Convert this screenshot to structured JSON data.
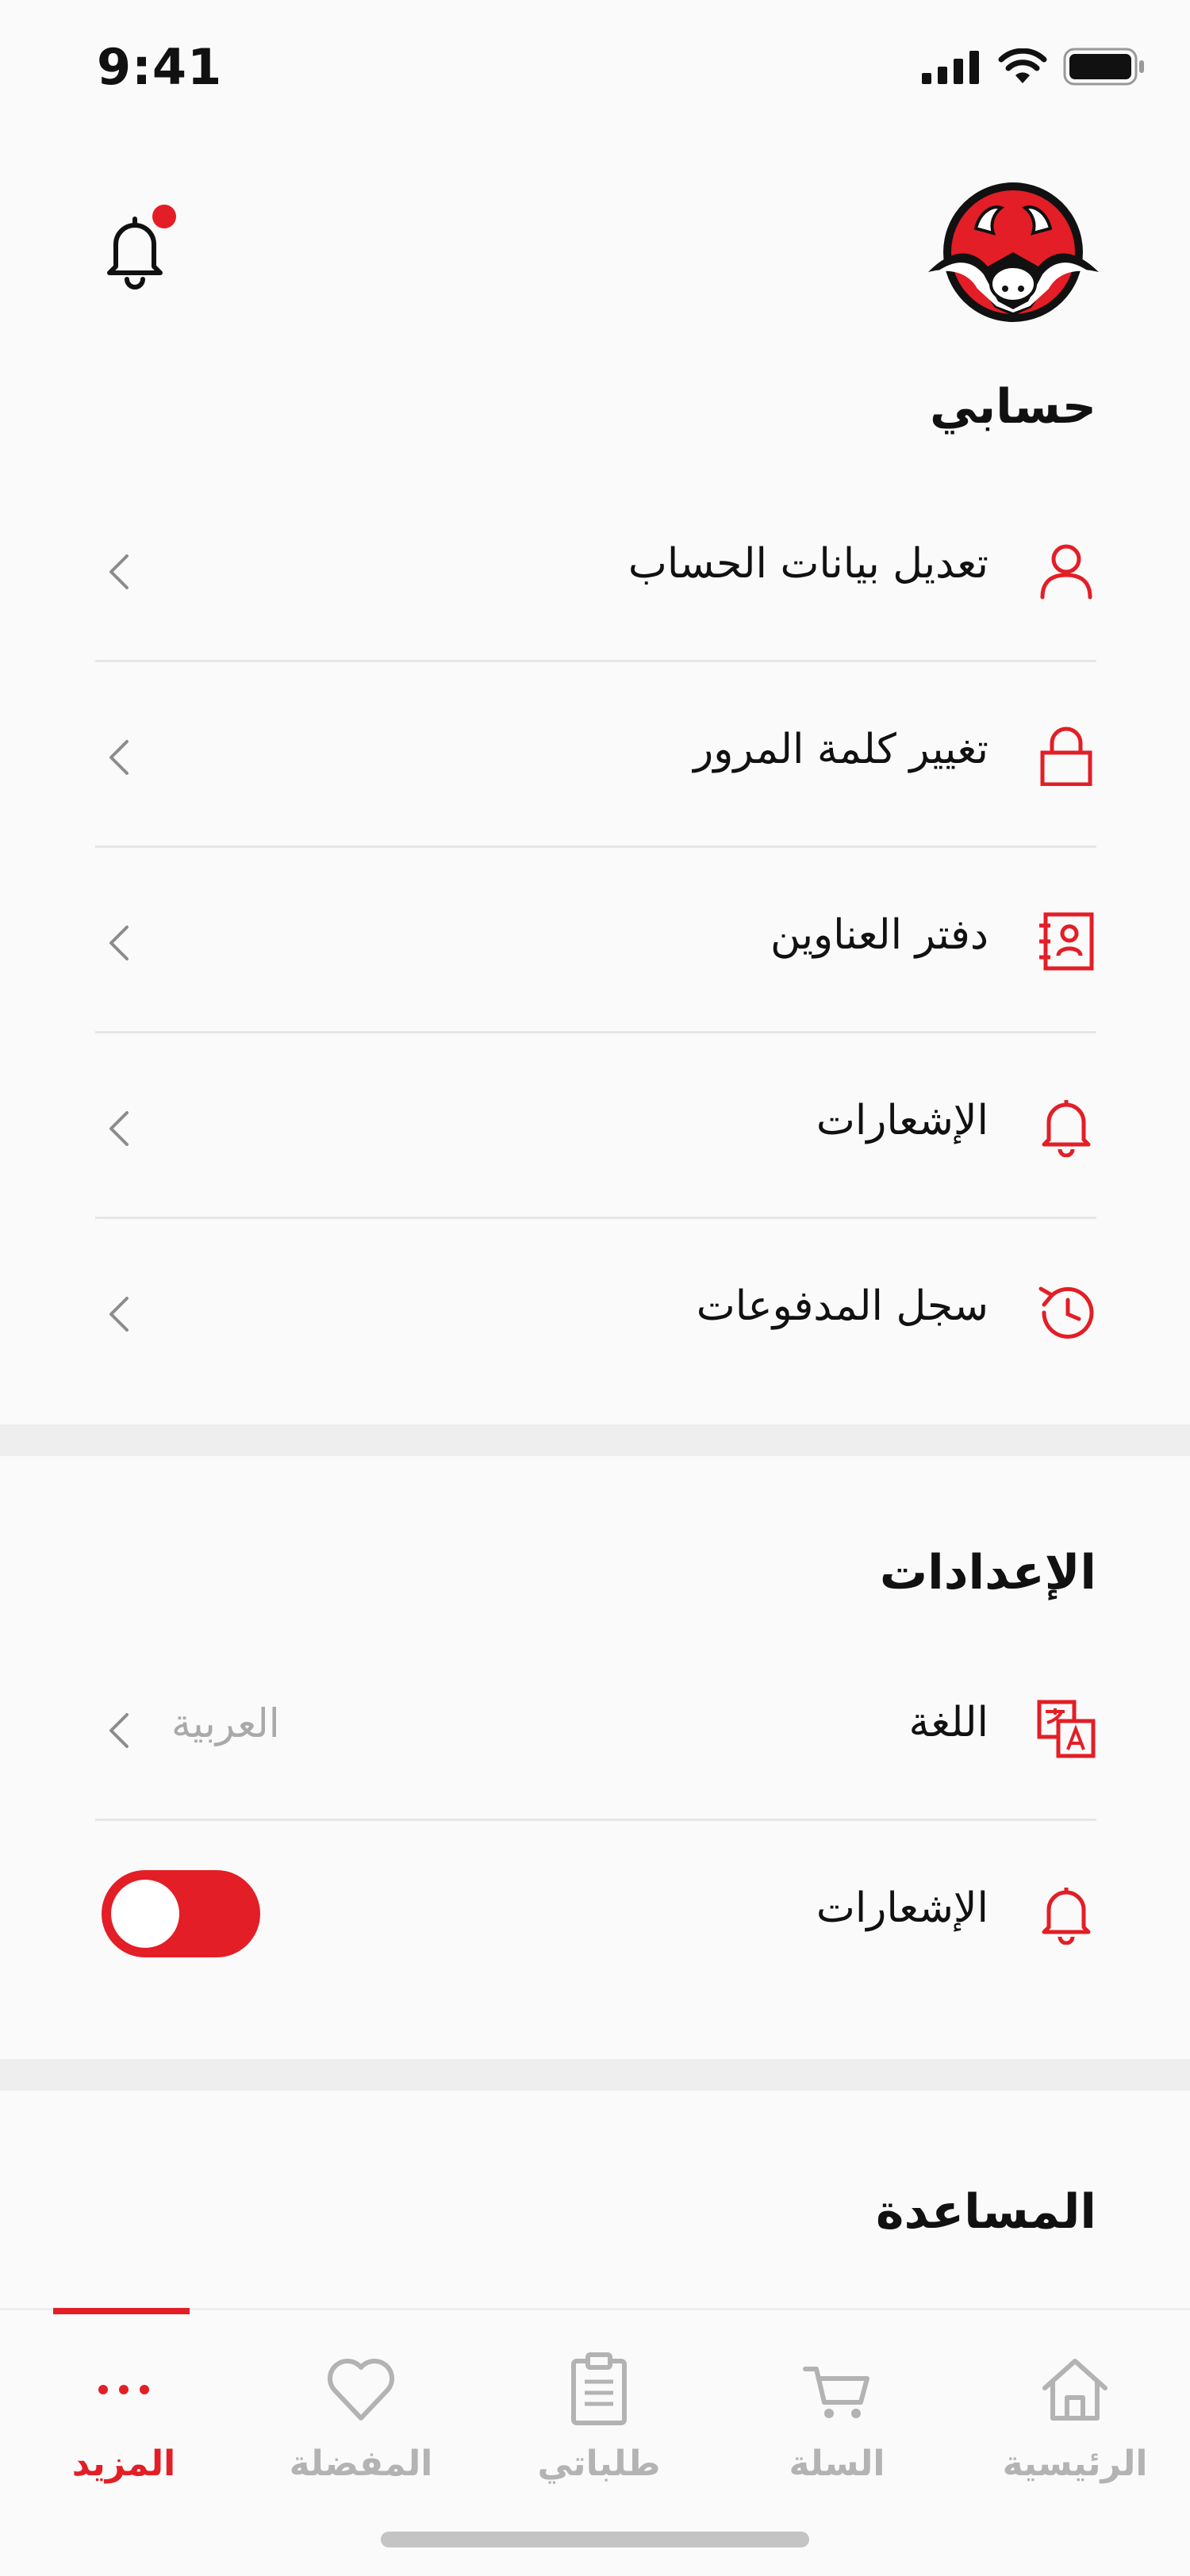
{
  "status": {
    "time": "9:41"
  },
  "colors": {
    "accent": "#e31e26",
    "muted": "#b3b3b3"
  },
  "account": {
    "title": "حسابي",
    "items": [
      {
        "label": "تعديل بيانات الحساب",
        "icon": "user-icon"
      },
      {
        "label": "تغيير كلمة المرور",
        "icon": "lock-icon"
      },
      {
        "label": "دفتر العناوين",
        "icon": "address-book-icon"
      },
      {
        "label": "الإشعارات",
        "icon": "bell-icon"
      },
      {
        "label": "سجل المدفوعات",
        "icon": "history-icon"
      }
    ]
  },
  "settings": {
    "title": "الإعدادات",
    "language": {
      "label": "اللغة",
      "value": "العربية",
      "icon": "translate-icon"
    },
    "notifications": {
      "label": "الإشعارات",
      "enabled": true,
      "icon": "bell-icon"
    }
  },
  "help": {
    "title": "المساعدة"
  },
  "tabs": [
    {
      "label": "الرئيسية",
      "icon": "home-icon",
      "active": false
    },
    {
      "label": "السلة",
      "icon": "cart-icon",
      "active": false
    },
    {
      "label": "طلباتي",
      "icon": "orders-icon",
      "active": false
    },
    {
      "label": "المفضلة",
      "icon": "heart-icon",
      "active": false
    },
    {
      "label": "المزيد",
      "icon": "more-icon",
      "active": true
    }
  ]
}
